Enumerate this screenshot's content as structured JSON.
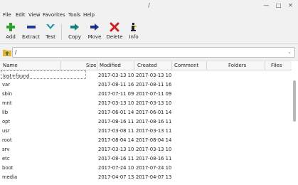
{
  "window": {
    "title": "/"
  },
  "menu": [
    "File",
    "Edit",
    "View",
    "Favorites",
    "Tools",
    "Help"
  ],
  "toolbar": {
    "add": "Add",
    "extract": "Extract",
    "test": "Test",
    "copy": "Copy",
    "move": "Move",
    "delete": "Delete",
    "info": "Info"
  },
  "address": {
    "path": "/"
  },
  "columns": {
    "name": "Name",
    "size": "Size",
    "modified": "Modified",
    "created": "Created",
    "comment": "Comment",
    "folders": "Folders",
    "files": "Files"
  },
  "rows": [
    {
      "name": "lost+found",
      "modified": "2017-03-13 10...",
      "created": "2017-03-13 10..."
    },
    {
      "name": "var",
      "modified": "2017-08-11 16...",
      "created": "2017-08-11 16..."
    },
    {
      "name": "sbin",
      "modified": "2017-07-11 09...",
      "created": "2017-07-11 09..."
    },
    {
      "name": "mnt",
      "modified": "2017-03-13 10...",
      "created": "2017-03-13 10..."
    },
    {
      "name": "lib",
      "modified": "2017-06-01 14...",
      "created": "2017-06-01 14..."
    },
    {
      "name": "opt",
      "modified": "2017-08-16 11...",
      "created": "2017-08-16 11..."
    },
    {
      "name": "usr",
      "modified": "2017-03-08 11...",
      "created": "2017-03-13 11..."
    },
    {
      "name": "root",
      "modified": "2017-08-04 14...",
      "created": "2017-08-04 14..."
    },
    {
      "name": "srv",
      "modified": "2017-03-13 10...",
      "created": "2017-03-13 10..."
    },
    {
      "name": "etc",
      "modified": "2017-08-16 11...",
      "created": "2017-08-16 11..."
    },
    {
      "name": "boot",
      "modified": "2017-07-24 10...",
      "created": "2017-07-24 10..."
    },
    {
      "name": "media",
      "modified": "2017-04-07 13...",
      "created": "2017-04-07 13..."
    }
  ],
  "icons": {
    "add": "green-plus-icon",
    "extract": "blue-minus-icon",
    "test": "teal-chevron-down-icon",
    "copy": "teal-arrow-right-icon",
    "move": "navy-arrow-right-icon",
    "delete": "red-x-icon",
    "info": "info-icon",
    "up": "folder-up-icon"
  },
  "colors": {
    "add": "#2e9e2e",
    "extract": "#1f3a8f",
    "test": "#1c98a8",
    "copy": "#177f7f",
    "move": "#1d2f85",
    "delete": "#cc1f1f"
  }
}
